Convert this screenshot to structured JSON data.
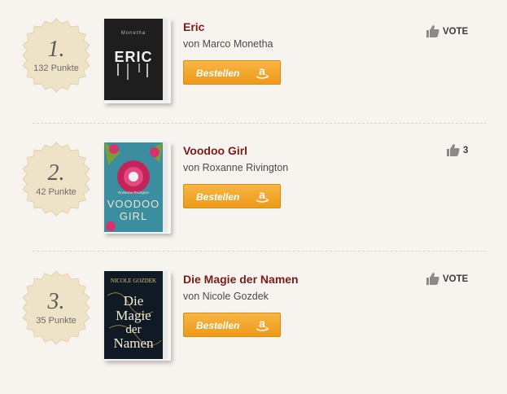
{
  "entries": [
    {
      "rank": "1.",
      "points": "132 Punkte",
      "title": "Eric",
      "author": "von Marco Monetha",
      "order_label": "Bestellen",
      "vote_label": "VOTE",
      "cover": {
        "top_text": "Monetha",
        "title_text": "ERIC",
        "bg": "#1e1e1e"
      }
    },
    {
      "rank": "2.",
      "points": "42 Punkte",
      "title": "Voodoo Girl",
      "author": "von Roxanne Rivington",
      "order_label": "Bestellen",
      "vote_label": "3",
      "cover": {
        "top_text": "Roxanne Rivington",
        "title_text": "VOODOO",
        "title_text2": "GIRL",
        "bg": "#3a8ea0"
      }
    },
    {
      "rank": "3.",
      "points": "35 Punkte",
      "title": "Die Magie der Namen",
      "author": "von Nicole Gozdek",
      "order_label": "Bestellen",
      "vote_label": "VOTE",
      "cover": {
        "top_text": "NICOLE GOZDEK",
        "title_text": "Die",
        "title_text2": "Magie",
        "title_text3": "der",
        "title_text4": "Namen",
        "bg": "#0f1a24"
      }
    }
  ],
  "colors": {
    "title": "#7a1b1b",
    "button": "#f0a020",
    "badge": "#efe3c7"
  }
}
